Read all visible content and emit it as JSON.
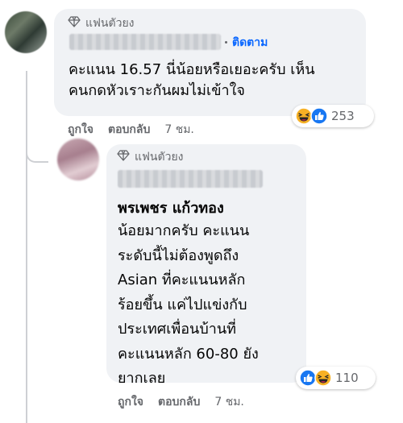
{
  "comment": {
    "badge": "แฟนตัวยง",
    "follow_label": "ติดตาม",
    "text": "คะแนน 16.57 นี่น้อยหรือเยอะครับ เห็น\nคนกดหัวเราะกันผมไม่เข้าใจ",
    "reaction_icons": [
      "haha-icon",
      "like-icon"
    ],
    "reaction_count": "253",
    "actions": {
      "like": "ถูกใจ",
      "reply": "ตอบกลับ",
      "time": "7 ชม."
    }
  },
  "reply": {
    "badge": "แฟนตัวยง",
    "author": "พรเพชร แก้วทอง",
    "text": "น้อยมากครับ คะแนน\nระดับนี้ไม่ต้องพูดถึง\nAsian ที่คะแนนหลัก\nร้อยขึ้น แค่ไปแข่งกับ\nประเทศเพื่อนบ้านที่\nคะแนนหลัก 60-80 ยัง\nยากเลย",
    "reaction_icons": [
      "like-icon",
      "haha-icon"
    ],
    "reaction_count": "110",
    "actions": {
      "like": "ถูกใจ",
      "reply": "ตอบกลับ",
      "time": "7 ชม."
    }
  },
  "colors": {
    "bubble": "#f0f2f5",
    "link": "#0866ff",
    "muted": "#65676b",
    "like": "#1877f2",
    "haha": "#f7b125"
  }
}
